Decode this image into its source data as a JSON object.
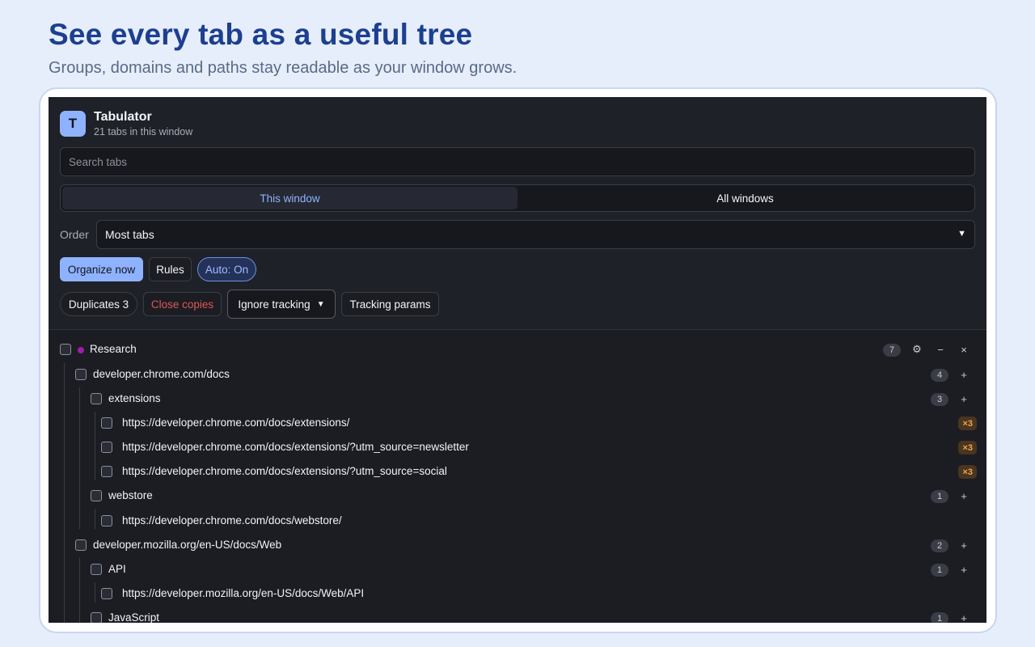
{
  "hero": {
    "title": "See every tab as a useful tree",
    "subtitle": "Groups, domains and paths stay readable as your window grows."
  },
  "app": {
    "logo_letter": "T",
    "name": "Tabulator",
    "tab_count_text": "21 tabs in this window"
  },
  "search": {
    "placeholder": "Search tabs",
    "value": ""
  },
  "scope_tabs": [
    {
      "label": "This window",
      "active": true
    },
    {
      "label": "All windows",
      "active": false
    }
  ],
  "order": {
    "label": "Order",
    "selected": "Most tabs"
  },
  "actions": {
    "organize": "Organize now",
    "rules": "Rules",
    "auto": "Auto: On"
  },
  "duplicates": {
    "label": "Duplicates 3",
    "close_copies": "Close copies",
    "tracking_mode": "Ignore tracking",
    "tracking_params": "Tracking params"
  },
  "icons": {
    "settings": "⚙",
    "collapse": "−",
    "close": "×",
    "add": "+",
    "chevron": "⌄"
  },
  "colors": {
    "accent": "#8fb2ff",
    "group_dot": "#9b1fa8",
    "duplicate_badge": "#f0a54a",
    "danger": "#e05555"
  },
  "tree": {
    "group": {
      "label": "Research",
      "count": "7"
    },
    "rows": [
      {
        "label": "developer.chrome.com/docs",
        "count": "4"
      },
      {
        "label": "extensions",
        "count": "3"
      },
      {
        "label": "https://developer.chrome.com/docs/extensions/",
        "dup": "×3"
      },
      {
        "label": "https://developer.chrome.com/docs/extensions/?utm_source=newsletter",
        "dup": "×3"
      },
      {
        "label": "https://developer.chrome.com/docs/extensions/?utm_source=social",
        "dup": "×3"
      },
      {
        "label": "webstore",
        "count": "1"
      },
      {
        "label": "https://developer.chrome.com/docs/webstore/"
      },
      {
        "label": "developer.mozilla.org/en-US/docs/Web",
        "count": "2"
      },
      {
        "label": "API",
        "count": "1"
      },
      {
        "label": "https://developer.mozilla.org/en-US/docs/Web/API"
      },
      {
        "label": "JavaScript",
        "count": "1"
      }
    ]
  }
}
